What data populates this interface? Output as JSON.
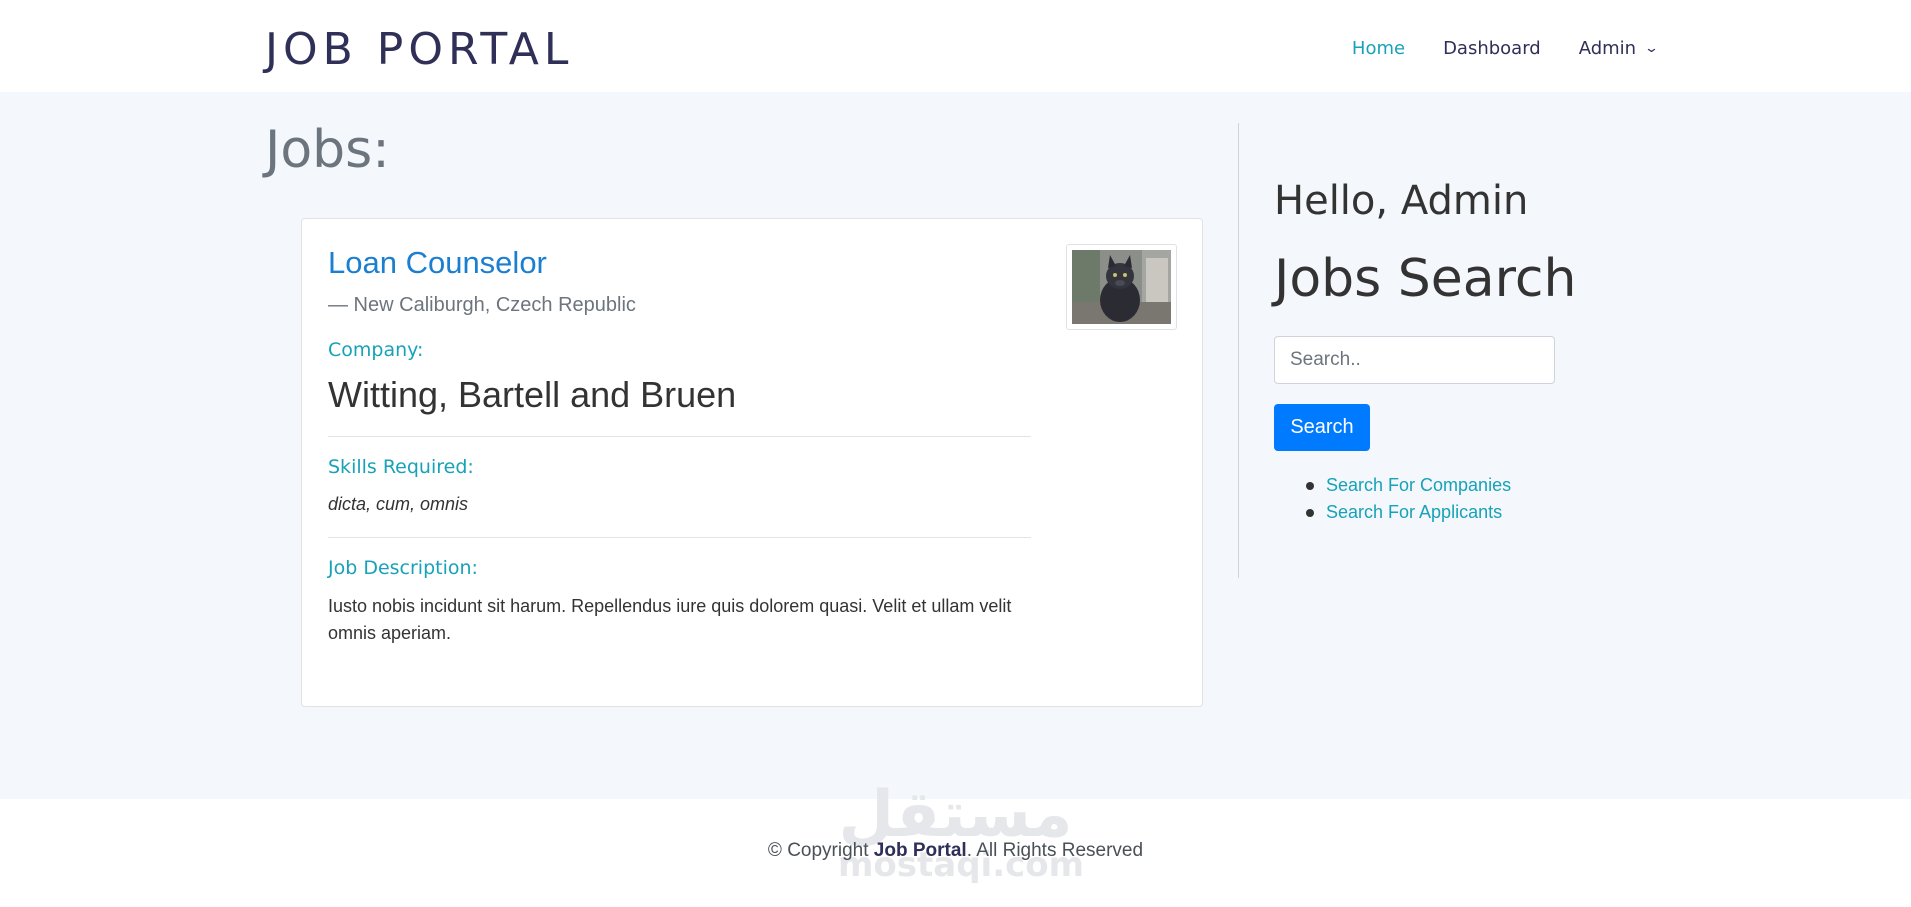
{
  "header": {
    "brand": "JOB PORTAL",
    "nav": [
      {
        "label": "Home",
        "active": true
      },
      {
        "label": "Dashboard",
        "active": false
      },
      {
        "label": "Admin",
        "dropdown": true
      }
    ]
  },
  "main": {
    "title": "Jobs:",
    "job": {
      "title": "Loan Counselor",
      "location": "— New Caliburgh, Czech Republic",
      "company_label": "Company:",
      "company": "Witting, Bartell and Bruen",
      "skills_label": "Skills Required:",
      "skills": "dicta, cum, omnis",
      "description_label": "Job Description:",
      "description": "Iusto nobis incidunt sit harum. Repellendus iure quis dolorem quasi. Velit et ullam velit omnis aperiam.",
      "thumbnail": "cat-photo"
    }
  },
  "sidebar": {
    "greeting": "Hello, Admin",
    "search_title": "Jobs Search",
    "search_placeholder": "Search..",
    "search_button": "Search",
    "links": [
      "Search For Companies",
      "Search For Applicants"
    ]
  },
  "footer": {
    "copyright_prefix": "© Copyright ",
    "copyright_brand": "Job Portal",
    "copyright_suffix": ". All Rights Reserved",
    "watermark_arabic": "مستقل",
    "watermark_latin": "mostaqi.com"
  },
  "colors": {
    "accent": "#17a2b8",
    "primary": "#007bff",
    "brand": "#2f2f58",
    "link": "#1a7fd1",
    "background": "#f4f7fb"
  }
}
